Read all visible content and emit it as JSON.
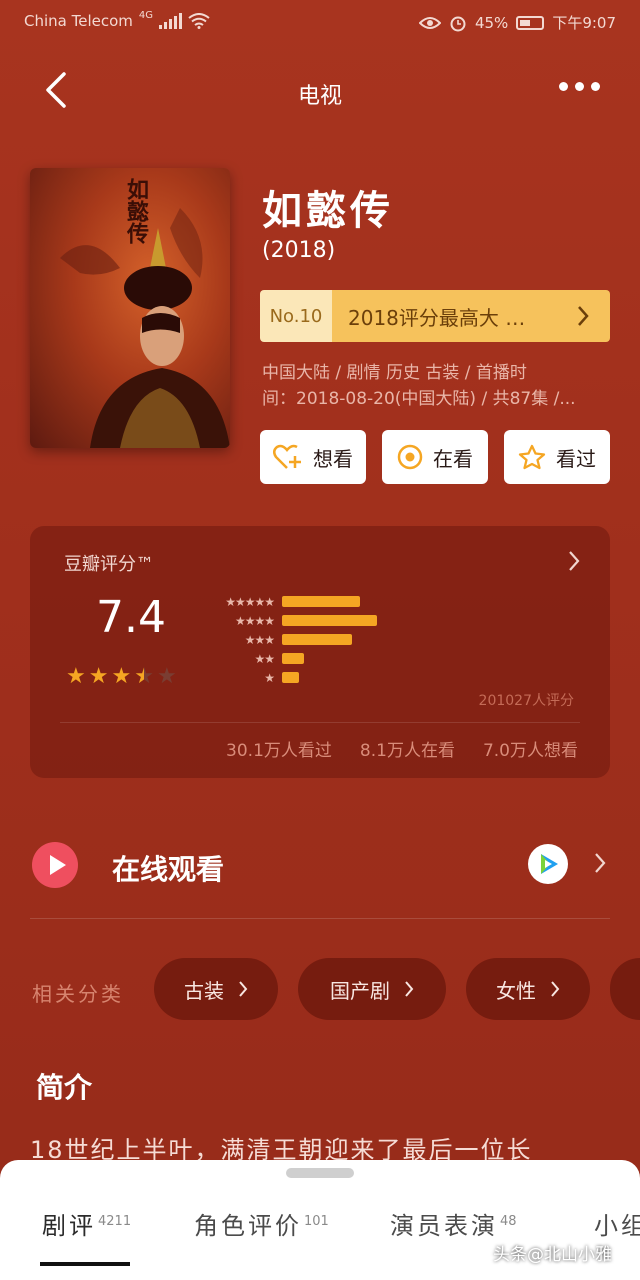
{
  "status_bar": {
    "carrier": "China Telecom",
    "network": "4G",
    "battery": "45%",
    "time": "下午9:07"
  },
  "nav": {
    "title": "电视"
  },
  "show": {
    "poster_title": "如懿传",
    "title": "如懿传",
    "year": "(2018)",
    "rank_no": "No.10",
    "rank_text": "2018评分最高大 …",
    "meta_line1": "中国大陆 / 剧情 历史 古装 / 首播时",
    "meta_line2": "间：2018-08-20(中国大陆) / 共87集 /..."
  },
  "actions": {
    "want": "想看",
    "watching": "在看",
    "watched": "看过"
  },
  "rating": {
    "label": "豆瓣评分™",
    "score": "7.4",
    "stars": 3.5,
    "distribution": [
      {
        "stars": "★★★★★",
        "fraction": 0.28
      },
      {
        "stars": "★★★★",
        "fraction": 0.34
      },
      {
        "stars": "★★★",
        "fraction": 0.25
      },
      {
        "stars": "★★",
        "fraction": 0.08
      },
      {
        "stars": "★",
        "fraction": 0.06
      }
    ],
    "count": "201027人评分",
    "watched": "30.1万人看过",
    "watching": "8.1万人在看",
    "want": "7.0万人想看"
  },
  "online": {
    "label": "在线观看"
  },
  "related": {
    "label": "相关分类",
    "chips": [
      "古装",
      "国产剧",
      "女性"
    ]
  },
  "intro": {
    "heading": "简介",
    "text": "18世纪上半叶，满清王朝迎来了最后一位长"
  },
  "tabs": [
    {
      "label": "剧评",
      "count": "4211"
    },
    {
      "label": "角色评价",
      "count": "101"
    },
    {
      "label": "演员表演",
      "count": "48"
    },
    {
      "label": "小组",
      "count": ""
    }
  ],
  "watermark": "头条@北山小雅",
  "colors": {
    "background": "#a8341f",
    "rank_gold": "#f6c25c",
    "bar_orange": "#f5a623",
    "play_red": "#ef4f5f"
  }
}
